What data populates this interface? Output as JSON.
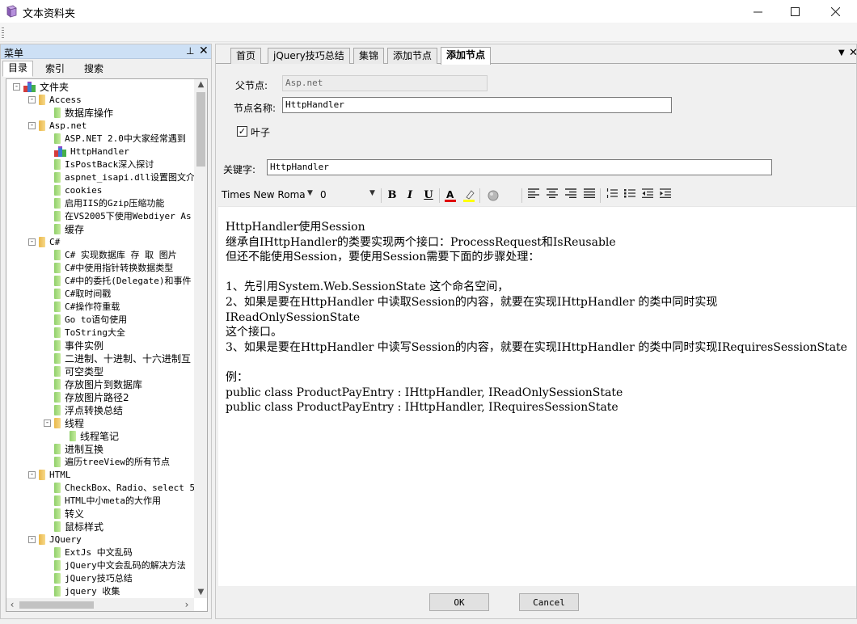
{
  "window": {
    "title": "文本资料夹"
  },
  "left_panel": {
    "title": "菜单",
    "tabs": [
      "目录",
      "索引",
      "搜索"
    ],
    "tree": [
      {
        "label": "文件夹",
        "kind": "root",
        "depth": 0,
        "expander": "-",
        "mono": false
      },
      {
        "label": "Access",
        "kind": "folder",
        "depth": 1,
        "expander": "-",
        "mono": true
      },
      {
        "label": "数据库操作",
        "kind": "leaf",
        "depth": 2,
        "mono": false
      },
      {
        "label": "Asp.net",
        "kind": "folder",
        "depth": 1,
        "expander": "-",
        "mono": true
      },
      {
        "label": "ASP.NET 2.0中大家经常遇到",
        "kind": "leaf",
        "depth": 2,
        "mono": true
      },
      {
        "label": "HttpHandler",
        "kind": "selected",
        "depth": 2,
        "mono": true
      },
      {
        "label": "IsPostBack深入探讨",
        "kind": "leaf",
        "depth": 2,
        "mono": true
      },
      {
        "label": "aspnet_isapi.dll设置图文介",
        "kind": "leaf",
        "depth": 2,
        "mono": true
      },
      {
        "label": "cookies",
        "kind": "leaf",
        "depth": 2,
        "mono": true
      },
      {
        "label": "启用IIS的Gzip压缩功能",
        "kind": "leaf",
        "depth": 2,
        "mono": true
      },
      {
        "label": "在VS2005下使用Webdiyer As",
        "kind": "leaf",
        "depth": 2,
        "mono": true
      },
      {
        "label": "缓存",
        "kind": "leaf",
        "depth": 2,
        "mono": false
      },
      {
        "label": "C#",
        "kind": "folder",
        "depth": 1,
        "expander": "-",
        "mono": true
      },
      {
        "label": "C# 实现数据库 存 取 图片",
        "kind": "leaf",
        "depth": 2,
        "mono": true
      },
      {
        "label": "C#中使用指针转换数据类型",
        "kind": "leaf",
        "depth": 2,
        "mono": true
      },
      {
        "label": "C#中的委托(Delegate)和事件",
        "kind": "leaf",
        "depth": 2,
        "mono": true
      },
      {
        "label": "C#取时间戳",
        "kind": "leaf",
        "depth": 2,
        "mono": true
      },
      {
        "label": "C#操作符重载",
        "kind": "leaf",
        "depth": 2,
        "mono": true
      },
      {
        "label": "Go to语句使用",
        "kind": "leaf",
        "depth": 2,
        "mono": true
      },
      {
        "label": "ToString大全",
        "kind": "leaf",
        "depth": 2,
        "mono": true
      },
      {
        "label": "事件实例",
        "kind": "leaf",
        "depth": 2,
        "mono": false
      },
      {
        "label": "二进制、十进制、十六进制互",
        "kind": "leaf",
        "depth": 2,
        "mono": false
      },
      {
        "label": "可空类型",
        "kind": "leaf",
        "depth": 2,
        "mono": false
      },
      {
        "label": "存放图片到数据库",
        "kind": "leaf",
        "depth": 2,
        "mono": false
      },
      {
        "label": "存放图片路径2",
        "kind": "leaf",
        "depth": 2,
        "mono": false
      },
      {
        "label": "浮点转换总结",
        "kind": "leaf",
        "depth": 2,
        "mono": false
      },
      {
        "label": "线程",
        "kind": "folder",
        "depth": 2,
        "expander": "-",
        "mono": false
      },
      {
        "label": "线程笔记",
        "kind": "leaf",
        "depth": 3,
        "mono": false
      },
      {
        "label": "进制互换",
        "kind": "leaf",
        "depth": 2,
        "mono": false
      },
      {
        "label": "遍历treeView的所有节点",
        "kind": "leaf",
        "depth": 2,
        "mono": true
      },
      {
        "label": "HTML",
        "kind": "folder",
        "depth": 1,
        "expander": "-",
        "mono": true
      },
      {
        "label": "CheckBox、Radio、select 5",
        "kind": "leaf",
        "depth": 2,
        "mono": true
      },
      {
        "label": "HTML中小meta的大作用",
        "kind": "leaf",
        "depth": 2,
        "mono": true
      },
      {
        "label": "转义",
        "kind": "leaf",
        "depth": 2,
        "mono": false
      },
      {
        "label": "鼠标样式",
        "kind": "leaf",
        "depth": 2,
        "mono": false
      },
      {
        "label": "JQuery",
        "kind": "folder",
        "depth": 1,
        "expander": "-",
        "mono": true
      },
      {
        "label": "ExtJs 中文乱码",
        "kind": "leaf",
        "depth": 2,
        "mono": true
      },
      {
        "label": "jQuery中文会乱码的解决方法",
        "kind": "leaf",
        "depth": 2,
        "mono": true
      },
      {
        "label": "jQuery技巧总结",
        "kind": "leaf",
        "depth": 2,
        "mono": true
      },
      {
        "label": "jquery 收集",
        "kind": "leaf",
        "depth": 2,
        "mono": true
      }
    ]
  },
  "doc_tabs": [
    "首页",
    "jQuery技巧总结",
    "集锦",
    "添加节点",
    "添加节点"
  ],
  "form": {
    "parent_label": "父节点:",
    "parent_value": "Asp.net",
    "name_label": "节点名称:",
    "name_value": "HttpHandler",
    "leaf_label": "叶子",
    "leaf_checked": true,
    "keyword_label": "关键字:",
    "keyword_value": "HttpHandler"
  },
  "editor": {
    "font": "Times New Roma",
    "size": "0",
    "lines": [
      "HttpHandler使用Session",
      "继承自IHttpHandler的类要实现两个接口：ProcessRequest和IsReusable",
      "但还不能使用Session，要使用Session需要下面的步骤处理：",
      "",
      "1、先引用System.Web.SessionState 这个命名空间，",
      "2、如果是要在HttpHandler 中读取Session的内容，就要在实现IHttpHandler 的类中同时实现IReadOnlySessionState",
      "这个接口。",
      "3、如果是要在HttpHandler 中读写Session的内容，就要在实现IHttpHandler 的类中同时实现IRequiresSessionState",
      "",
      "例：",
      "public class ProductPayEntry : IHttpHandler, IReadOnlySessionState",
      "public class ProductPayEntry : IHttpHandler, IRequiresSessionState"
    ]
  },
  "buttons": {
    "ok": "OK",
    "cancel": "Cancel"
  },
  "colors": {
    "panel_header": "#cde0f5",
    "font_color_bar": "#e00000",
    "highlight_bar": "#ffff00"
  }
}
